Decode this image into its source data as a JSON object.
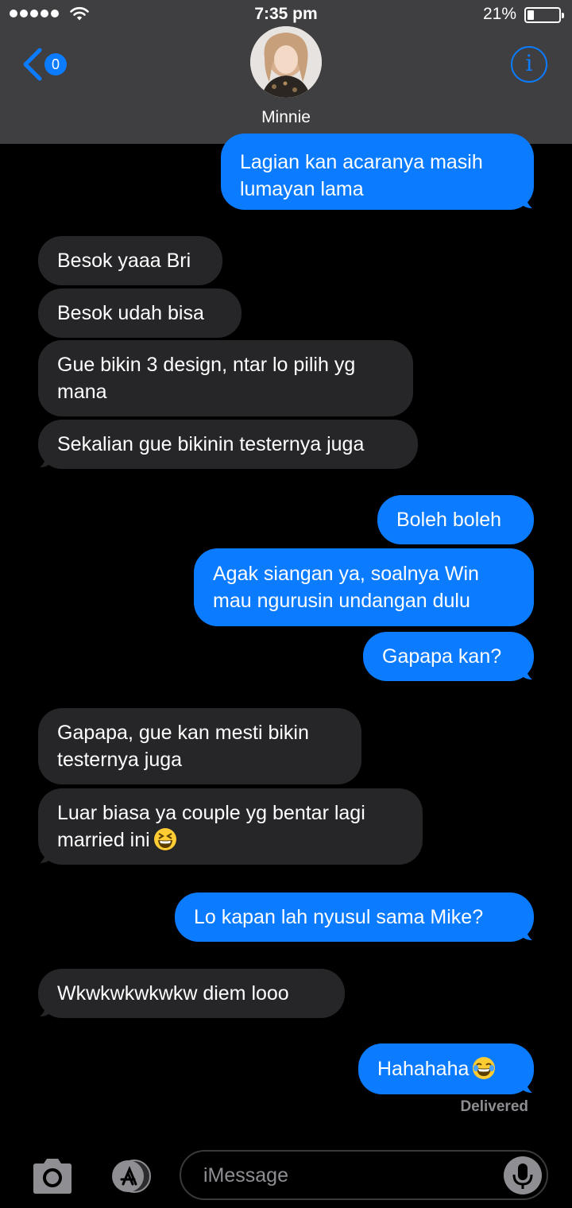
{
  "status_bar": {
    "time": "7:35 pm",
    "battery": "21%",
    "battery_level": 0.21
  },
  "header": {
    "back_badge": "0",
    "contact_name": "Minnie",
    "info_icon": "info-icon"
  },
  "messages": [
    {
      "dir": "out",
      "lines": [
        "Lagian kan acaranya masih",
        "lumayan lama"
      ]
    },
    {
      "dir": "in",
      "lines": [
        "Besok yaaa Bri"
      ]
    },
    {
      "dir": "in",
      "lines": [
        "Besok udah bisa"
      ]
    },
    {
      "dir": "in",
      "lines": [
        "Gue bikin 3 design, ntar lo pilih yg",
        "mana"
      ]
    },
    {
      "dir": "in",
      "lines": [
        "Sekalian gue bikinin testernya juga"
      ]
    },
    {
      "dir": "out",
      "lines": [
        "Boleh boleh"
      ]
    },
    {
      "dir": "out",
      "lines": [
        "Agak siangan ya, soalnya Win",
        "mau ngurusin undangan dulu"
      ]
    },
    {
      "dir": "out",
      "lines": [
        "Gapapa kan?"
      ]
    },
    {
      "dir": "in",
      "lines": [
        "Gapapa, gue kan mesti bikin",
        "testernya juga"
      ]
    },
    {
      "dir": "in",
      "lines": [
        "Luar biasa ya couple yg bentar lagi",
        "married ini"
      ],
      "emoji": "grinning-squinting-face"
    },
    {
      "dir": "out",
      "lines": [
        "Lo kapan lah nyusul sama Mike?"
      ]
    },
    {
      "dir": "in",
      "lines": [
        "Wkwkwkwkwkw diem looo"
      ]
    },
    {
      "dir": "out",
      "lines": [
        "Hahahaha"
      ],
      "emoji": "face-with-tears-of-joy"
    }
  ],
  "delivered_label": "Delivered",
  "input_bar": {
    "placeholder": "iMessage"
  },
  "colors": {
    "outgoing": "#0b7bff",
    "incoming": "#262629",
    "header": "#3f3f41",
    "accent": "#0b7bff"
  }
}
